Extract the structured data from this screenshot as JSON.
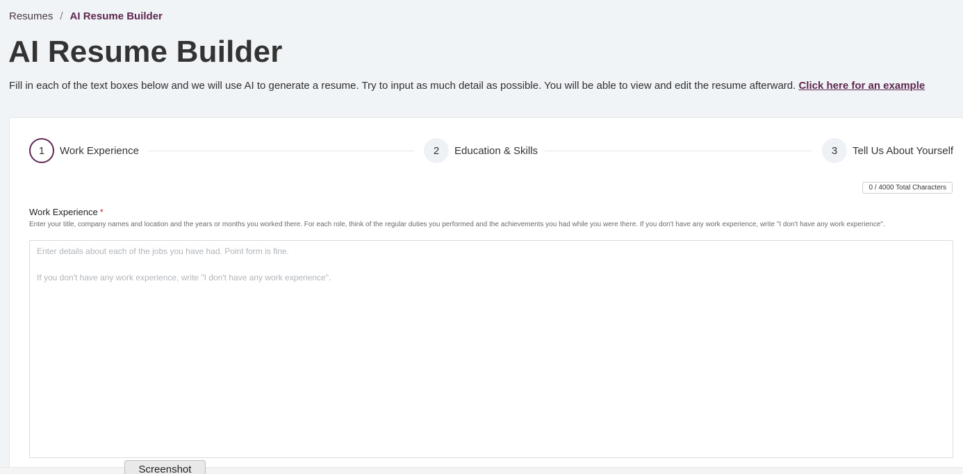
{
  "breadcrumb": {
    "parent": "Resumes",
    "separator": "/",
    "current": "AI Resume Builder"
  },
  "page": {
    "title": "AI Resume Builder",
    "intro": "Fill in each of the text boxes below and we will use AI to generate a resume. Try to input as much detail as possible. You will be able to view and edit the resume afterward. ",
    "example_link": "Click here for an example"
  },
  "stepper": {
    "steps": [
      {
        "number": "1",
        "label": "Work Experience",
        "active": true
      },
      {
        "number": "2",
        "label": "Education & Skills",
        "active": false
      },
      {
        "number": "3",
        "label": "Tell Us About Yourself",
        "active": false
      }
    ]
  },
  "form": {
    "char_count": "0 / 4000 Total Characters",
    "work_experience": {
      "label": "Work Experience",
      "required_marker": "*",
      "help": "Enter your title, company names and location and the years or months you worked there. For each role, think of the regular duties you performed and the achievements you had while you were there. If you don't have any work experience, write \"I don't have any work experience\".",
      "placeholder": "Enter details about each of the jobs you have had. Point form is fine.\n\nIf you don't have any work experience, write \"I don't have any work experience\".",
      "value": ""
    }
  },
  "overlay": {
    "screenshot_tab": "Screenshot"
  },
  "colors": {
    "accent": "#5e2750",
    "background": "#f1f4f7",
    "required": "#d3262b"
  }
}
